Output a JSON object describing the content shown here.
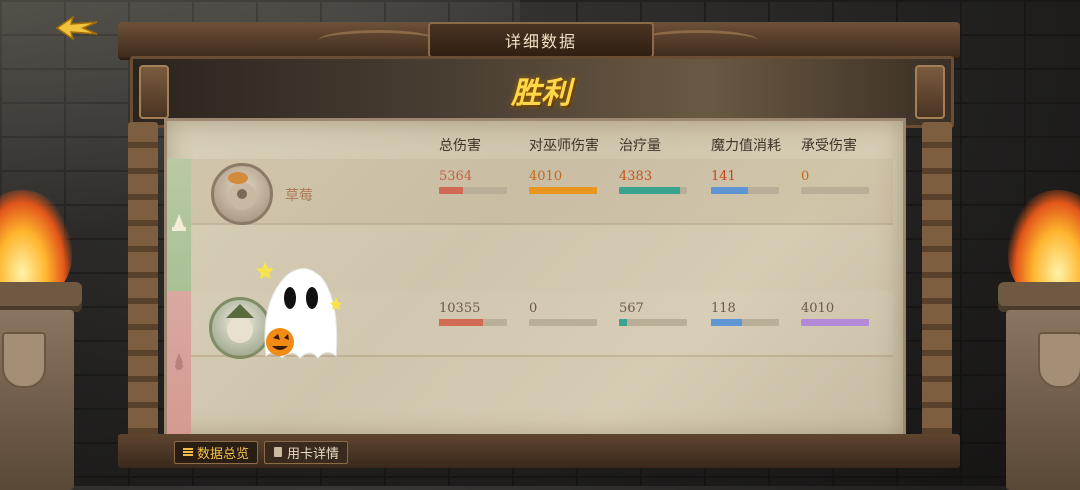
{
  "header": {
    "title": "详细数据",
    "result": "胜利"
  },
  "columns": [
    "总伤害",
    "对巫师伤害",
    "治疗量",
    "魔力值消耗",
    "承受伤害"
  ],
  "players": [
    {
      "name": "草莓",
      "team": "win",
      "stats": [
        5364,
        4010,
        4383,
        141,
        0
      ],
      "bars": [
        0.35,
        1.0,
        0.9,
        0.55,
        0.0
      ]
    },
    {
      "name": "",
      "team": "lose",
      "stats": [
        10355,
        0,
        567,
        118,
        4010
      ],
      "bars": [
        0.65,
        0.0,
        0.12,
        0.45,
        1.0
      ]
    }
  ],
  "value_colors": [
    "#c2633f",
    "#c4681e",
    "#c4541e",
    "#c4451e",
    "#c4681e"
  ],
  "value_colors_row2": [
    "#6b5a45",
    "#6b5a45",
    "#6b5a45",
    "#6b5a45",
    "#6b5a45"
  ],
  "bar_colors": [
    "#d06a55",
    "#e8961e",
    "#3aa38f",
    "#5f95d3",
    "#b38ad6"
  ],
  "tabs": [
    {
      "label": "数据总览",
      "active": true
    },
    {
      "label": "用卡详情",
      "active": false
    }
  ],
  "icons": {
    "back": "back-arrow-icon",
    "overview": "list-icon",
    "cards": "card-icon",
    "ghost": "ghost-pumpkin-sticker"
  }
}
